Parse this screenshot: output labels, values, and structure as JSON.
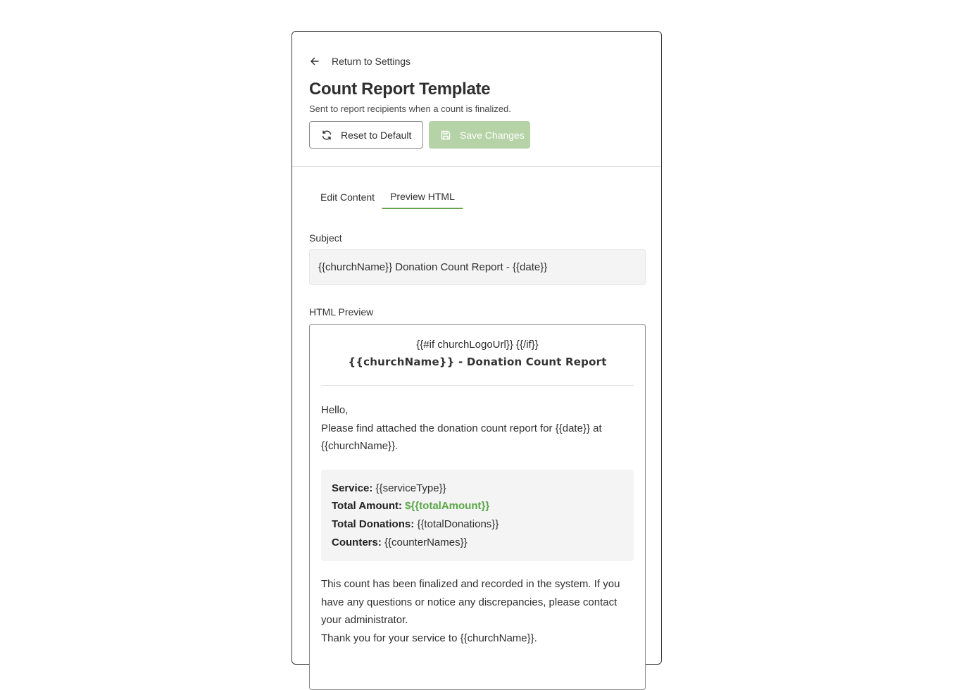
{
  "header": {
    "back_label": "Return to Settings",
    "title": "Count Report Template",
    "subtitle": "Sent to report recipients when a count is finalized.",
    "reset_label": "Reset to Default",
    "save_label": "Save Changes"
  },
  "tabs": [
    {
      "label": "Edit Content",
      "active": false
    },
    {
      "label": "Preview HTML",
      "active": true
    }
  ],
  "subject": {
    "label": "Subject",
    "value": "{{churchName}} Donation Count Report - {{date}}"
  },
  "preview": {
    "label": "HTML Preview",
    "if_line": "{{#if churchLogoUrl}} {{/if}}",
    "heading": "{{churchName}} - Donation Count Report",
    "greeting": "Hello,",
    "intro": "Please find attached the donation count report for {{date}} at {{churchName}}.",
    "details": {
      "service_label": "Service:",
      "service_value": "{{serviceType}}",
      "total_amount_label": "Total Amount:",
      "total_amount_value": "${{totalAmount}}",
      "total_donations_label": "Total Donations:",
      "total_donations_value": "{{totalDonations}}",
      "counters_label": "Counters:",
      "counters_value": "{{counterNames}}"
    },
    "closing": "This count has been finalized and recorded in the system. If you have any questions or notice any discrepancies, please contact your administrator.",
    "thanks": "Thank you for your service to {{churchName}}."
  },
  "colors": {
    "accent_green": "#68a24f",
    "amount_green": "#5aa747",
    "save_disabled": "#b5d3a6"
  },
  "icons": {
    "back": "arrow-left-icon",
    "reset": "refresh-icon",
    "save": "save-icon"
  }
}
